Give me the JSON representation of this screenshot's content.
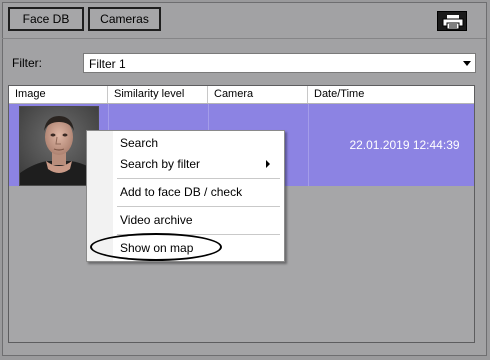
{
  "toolbar": {
    "face_db_label": "Face DB",
    "cameras_label": "Cameras",
    "print_icon": "printer-icon"
  },
  "filter": {
    "label": "Filter:",
    "selected": "Filter 1"
  },
  "table": {
    "columns": [
      "Image",
      "Similarity level",
      "Camera",
      "Date/Time"
    ],
    "rows": [
      {
        "similarity": "",
        "camera": "",
        "datetime": "22.01.2019 12:44:39"
      }
    ]
  },
  "context_menu": {
    "items": [
      "Search",
      "Search by filter",
      "Add to face DB / check",
      "Video archive",
      "Show on map"
    ]
  },
  "colors": {
    "selected_row": "#8c83e3",
    "background": "#a2a2a4"
  }
}
